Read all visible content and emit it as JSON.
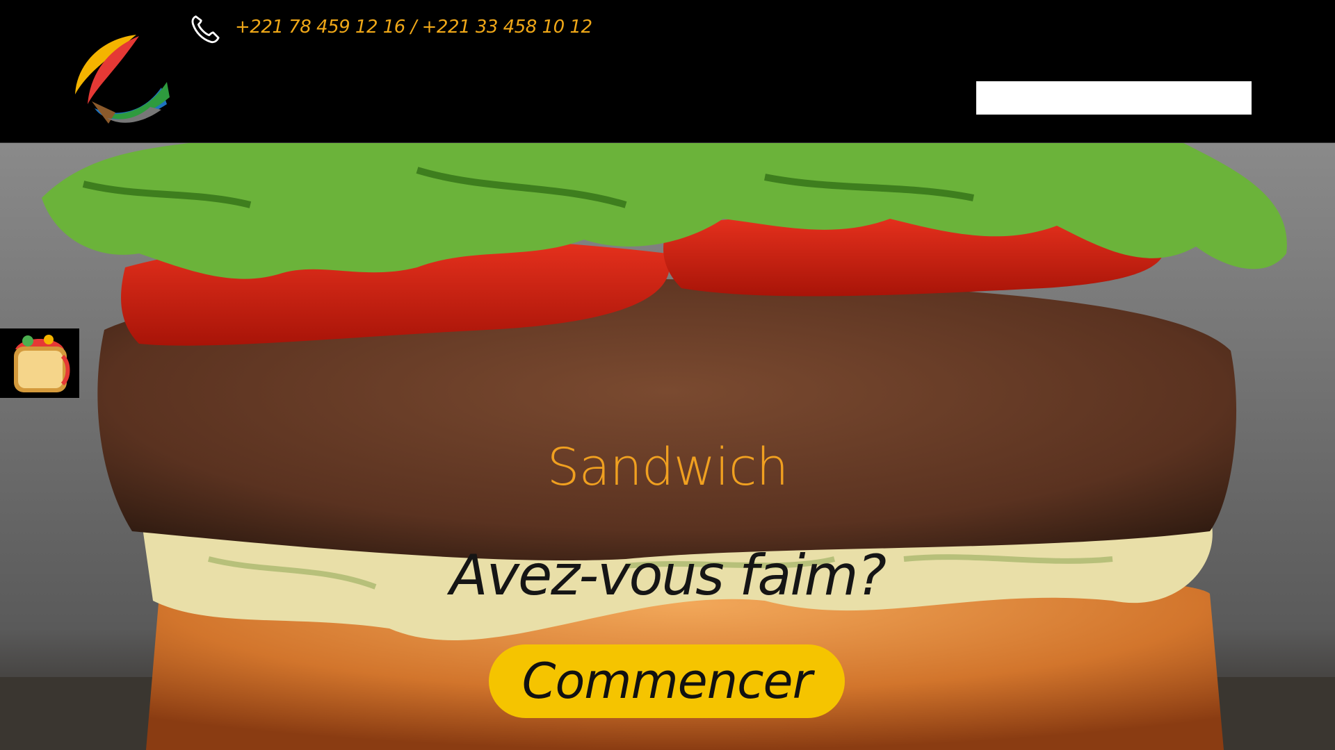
{
  "header": {
    "logo_icon": "swoosh-logo-icon",
    "phone_icon": "phone-icon",
    "phone": "+221 78 459 12 16 / +221 33 458 10 12",
    "search": {
      "value": "",
      "placeholder": ""
    }
  },
  "hero": {
    "background": "burger-photo",
    "badge_icon": "sandwich-icon",
    "title": "Sandwich",
    "subtitle": "Avez-vous faim?",
    "cta_label": "Commencer"
  },
  "colors": {
    "accent": "#f0a818",
    "button": "#f5c400",
    "header_bg": "#000000"
  }
}
